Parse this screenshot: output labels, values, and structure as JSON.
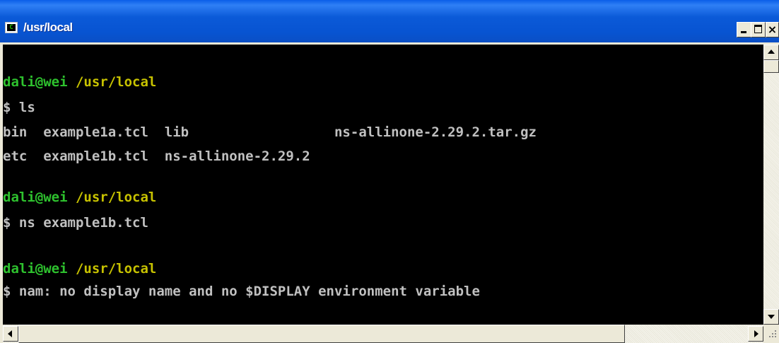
{
  "window": {
    "title": "/usr/local",
    "icon": "cygwin-terminal-icon",
    "icon_glyph": "C",
    "controls": {
      "close_label": "×"
    }
  },
  "colors": {
    "titlebar": "#0854d2",
    "terminal_bg": "#000000",
    "text": "#c0c0c0",
    "prompt_user": "#2ec22e",
    "prompt_path": "#c7c200"
  },
  "terminal": {
    "lines": [
      {
        "type": "prompt",
        "user": "dali@wei",
        "path": "/usr/local"
      },
      {
        "type": "text",
        "text": "$ ls"
      },
      {
        "type": "text",
        "text": "bin  example1a.tcl  lib                  ns-allinone-2.29.2.tar.gz"
      },
      {
        "type": "text",
        "text": "etc  example1b.tcl  ns-allinone-2.29.2"
      },
      {
        "type": "blank"
      },
      {
        "type": "prompt",
        "user": "dali@wei",
        "path": "/usr/local"
      },
      {
        "type": "text",
        "text": "$ ns example1b.tcl"
      },
      {
        "type": "blank"
      },
      {
        "type": "prompt",
        "user": "dali@wei",
        "path": "/usr/local"
      },
      {
        "type": "text",
        "text": "$ nam: no display name and no $DISPLAY environment variable"
      }
    ]
  }
}
